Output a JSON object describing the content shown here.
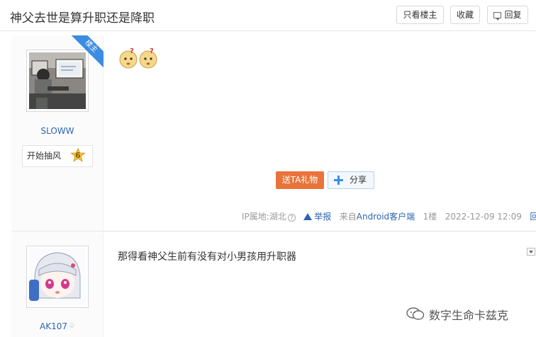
{
  "thread": {
    "title": "神父去世是算升职还是降职"
  },
  "toolbar": {
    "only_lz": "只看楼主",
    "favorite": "收藏",
    "reply": "回复"
  },
  "posts": [
    {
      "username": "SLOWW",
      "level_name": "开始抽风",
      "level": "6",
      "badge": "楼主",
      "actions": {
        "gift": "送TA礼物",
        "share": "分享"
      },
      "meta": {
        "ip": "IP属地:湖北",
        "ip_help": "?",
        "report": "举报",
        "source_prefix": "来自",
        "source": "Android客户端",
        "floor": "1楼",
        "time": "2022-12-09 12:09",
        "reply": "回复"
      }
    },
    {
      "username": "AK107",
      "content": "那得看神父生前有没有对小男孩用升职器"
    }
  ],
  "watermark": {
    "text": "数字生命卡兹克"
  },
  "colors": {
    "link": "#2d64b3",
    "gift": "#e9733a",
    "badge": "#3b8ce3"
  }
}
